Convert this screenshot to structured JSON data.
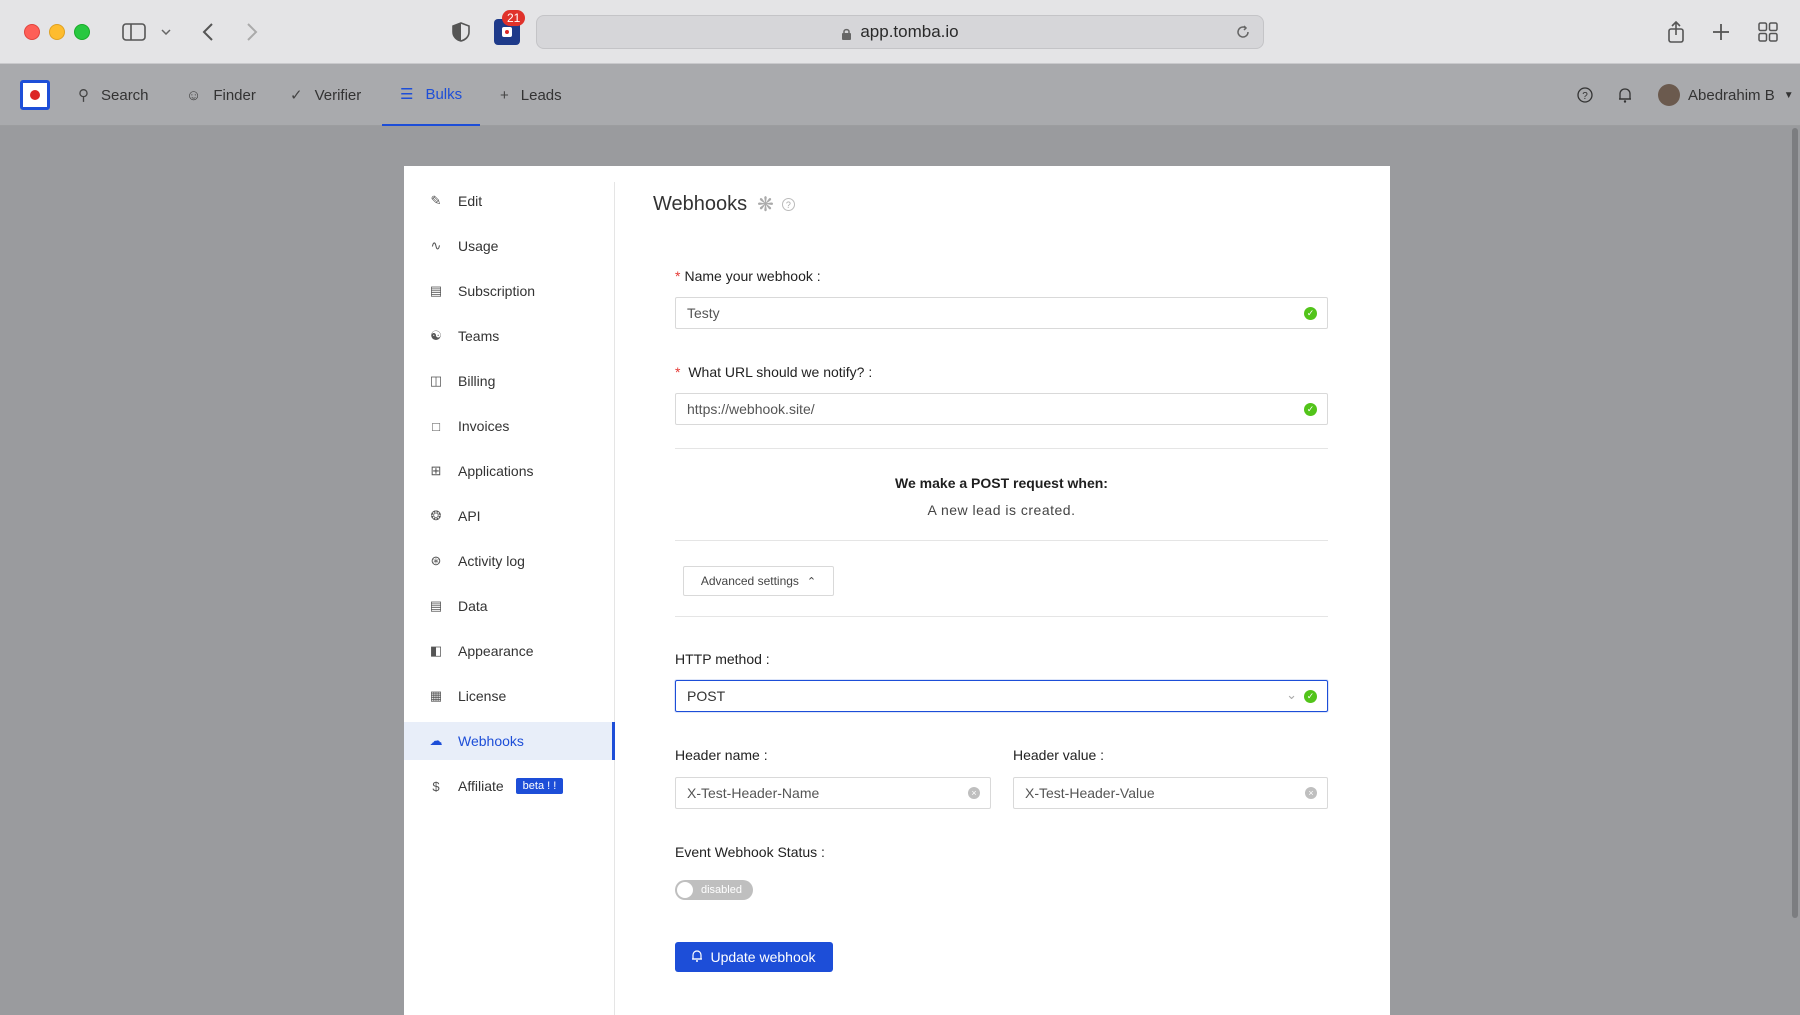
{
  "browser": {
    "url": "app.tomba.io",
    "tab_badge": "21"
  },
  "nav": {
    "items": [
      {
        "label": "Search",
        "icon": "search-icon"
      },
      {
        "label": "Finder",
        "icon": "user-icon"
      },
      {
        "label": "Verifier",
        "icon": "check-icon"
      },
      {
        "label": "Bulks",
        "icon": "list-icon",
        "active": true
      },
      {
        "label": "Leads",
        "icon": "plus-icon"
      }
    ],
    "user_name": "Abedrahim B"
  },
  "sidebar": {
    "items": [
      {
        "label": "Edit",
        "icon": "edit-icon"
      },
      {
        "label": "Usage",
        "icon": "chart-icon"
      },
      {
        "label": "Subscription",
        "icon": "card-icon"
      },
      {
        "label": "Teams",
        "icon": "team-icon"
      },
      {
        "label": "Billing",
        "icon": "file-icon"
      },
      {
        "label": "Invoices",
        "icon": "doc-icon"
      },
      {
        "label": "Applications",
        "icon": "apps-icon"
      },
      {
        "label": "API",
        "icon": "api-icon"
      },
      {
        "label": "Activity log",
        "icon": "cluster-icon"
      },
      {
        "label": "Data",
        "icon": "database-icon"
      },
      {
        "label": "Appearance",
        "icon": "layout-icon"
      },
      {
        "label": "License",
        "icon": "qrcode-icon"
      },
      {
        "label": "Webhooks",
        "icon": "cloud-icon",
        "active": true
      },
      {
        "label": "Affiliate",
        "icon": "dollar-icon",
        "badge": "beta ! !"
      }
    ]
  },
  "form": {
    "title": "Webhooks",
    "name_label": "Name your webhook",
    "name_value": "Testy",
    "url_label": "What URL should we notify?",
    "url_value": "https://webhook.site/",
    "post_heading": "We make a POST request when:",
    "post_event": "A new lead is created.",
    "advanced_label": "Advanced settings",
    "method_label": "HTTP method",
    "method_value": "POST",
    "header_name_label": "Header name",
    "header_name_value": "X-Test-Header-Name",
    "header_value_label": "Header value",
    "header_value_value": "X-Test-Header-Value",
    "status_label": "Event Webhook Status",
    "status_value": "disabled",
    "submit_label": "Update webhook"
  },
  "colors": {
    "primary": "#1d4ed8",
    "success": "#52c41a",
    "required": "#e53935"
  }
}
